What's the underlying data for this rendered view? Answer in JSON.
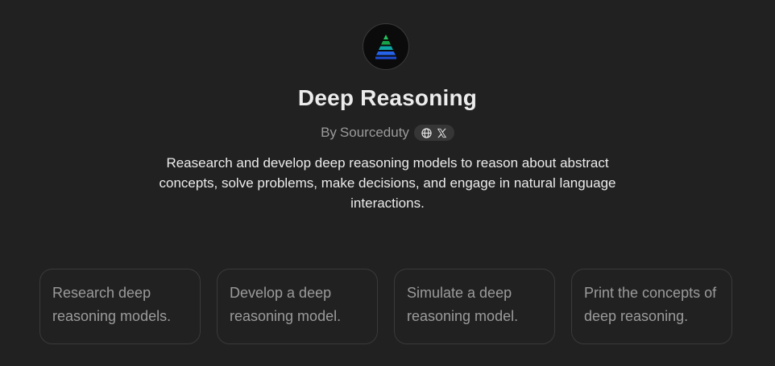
{
  "gpt": {
    "icon": "pyramid-logo",
    "title": "Deep Reasoning",
    "author_prefix": "By",
    "author": "Sourceduty",
    "social": [
      {
        "icon": "globe-icon"
      },
      {
        "icon": "x-logo-icon"
      }
    ],
    "description": "Reasearch and develop deep reasoning models to reason about abstract concepts, solve problems, make decisions, and engage in natural language interactions."
  },
  "starters": [
    {
      "text": "Research deep reasoning models."
    },
    {
      "text": "Develop a deep reasoning model."
    },
    {
      "text": "Simulate a deep reasoning model."
    },
    {
      "text": "Print the concepts of deep reasoning."
    }
  ],
  "colors": {
    "background": "#212121",
    "card_border": "#3a3a3a",
    "muted_text": "#9b9b9b",
    "pill_bg": "#363636"
  }
}
